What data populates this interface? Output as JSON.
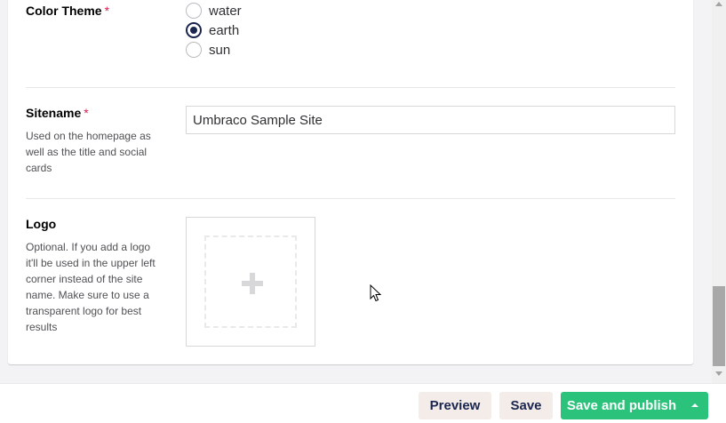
{
  "color_theme": {
    "label": "Color Theme",
    "required_marker": "*",
    "options": [
      {
        "label": "water",
        "checked": false
      },
      {
        "label": "earth",
        "checked": true
      },
      {
        "label": "sun",
        "checked": false
      }
    ]
  },
  "sitename": {
    "label": "Sitename",
    "required_marker": "*",
    "description": "Used on the homepage as well as the title and social cards",
    "value": "Umbraco Sample Site"
  },
  "logo": {
    "label": "Logo",
    "description": "Optional. If you add a logo it'll be used in the upper left corner instead of the site name. Make sure to use a transparent logo for best results",
    "add_icon": "plus-icon"
  },
  "footer": {
    "preview_label": "Preview",
    "save_label": "Save",
    "save_publish_label": "Save and publish",
    "publish_menu_icon": "caret-up-icon"
  },
  "colors": {
    "accent_green": "#2bc37c",
    "required_red": "#d42054",
    "secondary_button": "#f3ece9",
    "text_navy": "#1b264f"
  }
}
